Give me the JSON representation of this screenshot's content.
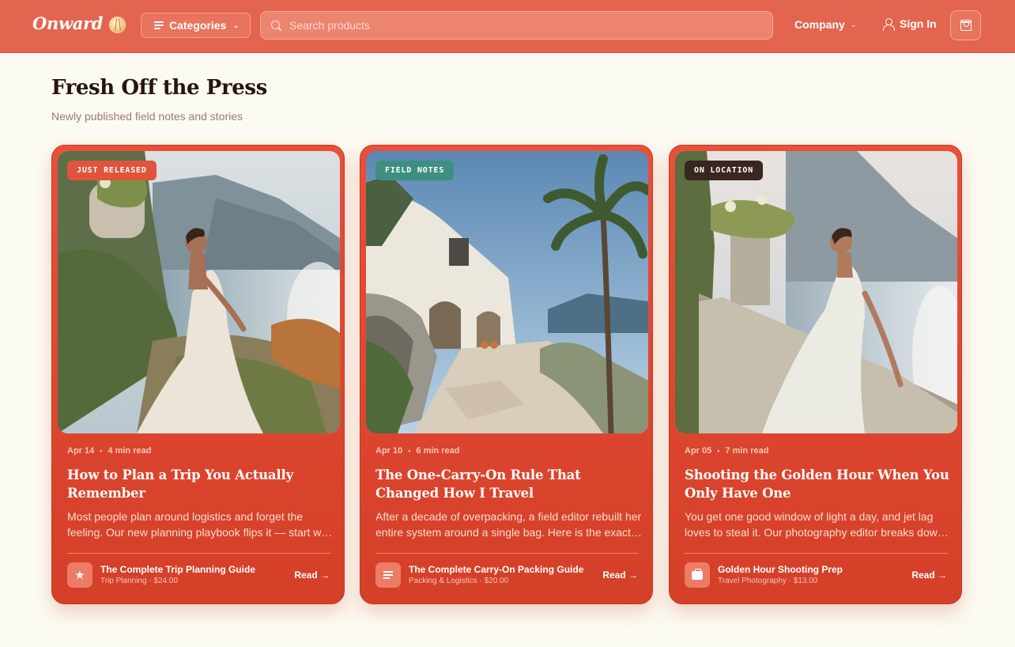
{
  "header": {
    "logo": "Onward",
    "categories_label": "Categories",
    "search_placeholder": "Search products",
    "company_label": "Company",
    "signin_label": "Sign In"
  },
  "section": {
    "title": "Fresh Off the Press",
    "subtitle": "Newly published field notes and stories"
  },
  "cards": [
    {
      "badge": "JUST RELEASED",
      "badge_color": "#e0533c",
      "date": "Apr 14",
      "read_time": "4 min read",
      "title": "How to Plan a Trip You Actually Remember",
      "excerpt": "Most people plan around logistics and forget the feeling. Our new planning playbook flips it — start with the feeling you want to bring home.",
      "product_icon": "star-icon",
      "product_name": "The Complete Trip Planning Guide",
      "product_meta": "Trip Planning · $24.00",
      "read_label": "Read →"
    },
    {
      "badge": "FIELD NOTES",
      "badge_color": "#3f8f80",
      "date": "Apr 10",
      "read_time": "6 min read",
      "title": "The One-Carry-On Rule That Changed How I Travel",
      "excerpt": "After a decade of overpacking, a field editor rebuilt her entire system around a single bag. Here is the exact list she uses now.",
      "product_icon": "document-lines-icon",
      "product_name": "The Complete Carry-On Packing Guide",
      "product_meta": "Packing & Logistics · $20.00",
      "read_label": "Read →"
    },
    {
      "badge": "ON LOCATION",
      "badge_color": "#3a2620",
      "date": "Apr 05",
      "read_time": "7 min read",
      "title": "Shooting the Golden Hour When You Only Have One",
      "excerpt": "You get one good window of light a day, and jet lag loves to steal it. Our photography editor breaks down how to catch it anyway.",
      "product_icon": "briefcase-icon",
      "product_name": "Golden Hour Shooting Prep",
      "product_meta": "Travel Photography · $13.00",
      "read_label": "Read →"
    }
  ]
}
